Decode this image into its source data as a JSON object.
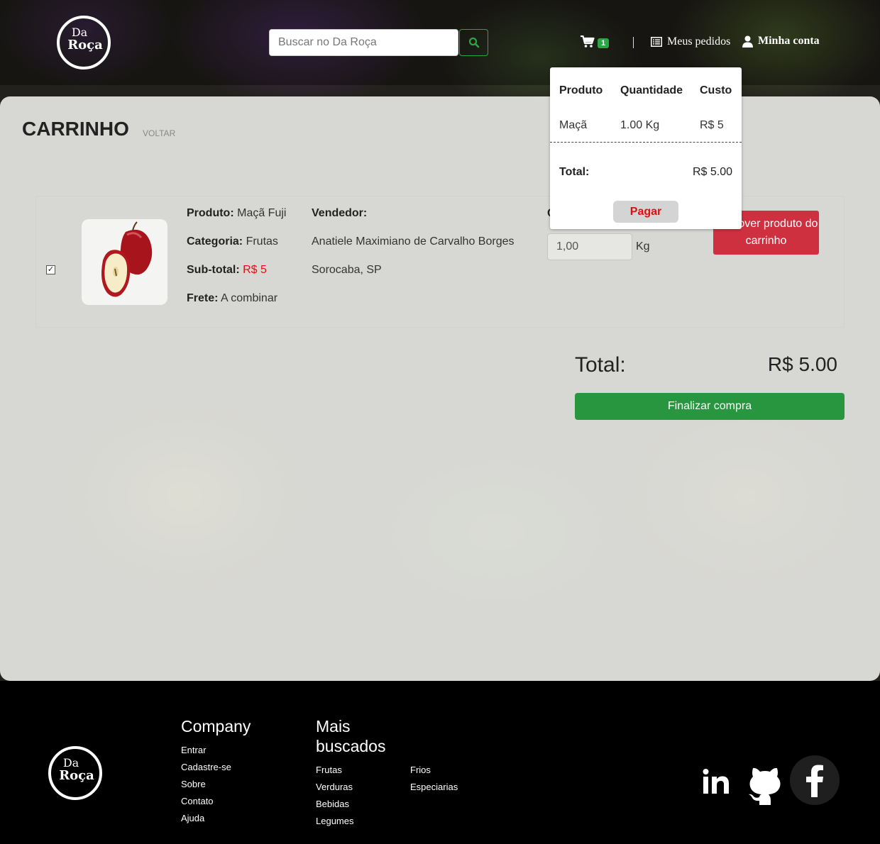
{
  "header": {
    "logo_line1": "Da",
    "logo_line2": "Roça",
    "search_placeholder": "Buscar no Da Roça",
    "cart_count": "1",
    "orders_label": "Meus pedidos",
    "account_label": "Minha conta"
  },
  "page": {
    "title": "CARRINHO",
    "back_label": "VOLTAR"
  },
  "cart_item": {
    "checked": true,
    "product_label": "Produto:",
    "product_value": "Maçã Fuji",
    "category_label": "Categoria:",
    "category_value": "Frutas",
    "subtotal_label": "Sub-total:",
    "subtotal_value": "R$ 5",
    "shipping_label": "Frete:",
    "shipping_value": "A combinar",
    "seller_label": "Vendedor:",
    "seller_name": "Anatiele Maximiano de Carvalho Borges",
    "seller_location": "Sorocaba, SP",
    "quantity_value": "1,00",
    "quantity_unit": "Kg",
    "remove_label": "Remover produto do carrinho"
  },
  "summary": {
    "total_label": "Total:",
    "total_value": "R$ 5.00",
    "checkout_label": "Finalizar compra"
  },
  "cart_popup": {
    "headers": [
      "Produto",
      "Quantidade",
      "Custo"
    ],
    "row": [
      "Maçã",
      "1.00 Kg",
      "R$ 5"
    ],
    "total_label": "Total:",
    "total_value": "R$ 5.00",
    "pay_label": "Pagar"
  },
  "footer": {
    "company_heading": "Company",
    "company_links": [
      "Entrar",
      "Cadastre-se",
      "Sobre",
      "Contato",
      "Ajuda"
    ],
    "popular_heading_1": "Mais",
    "popular_heading_2": "buscados",
    "popular_links_col1": [
      "Frutas",
      "Verduras",
      "Bebidas",
      "Legumes"
    ],
    "popular_links_col2": [
      "Frios",
      "Especiarias"
    ],
    "social": [
      "linkedin-icon",
      "github-icon",
      "facebook-icon"
    ]
  },
  "colors": {
    "green": "#28a745",
    "red": "#cf3040",
    "price_red": "#e01010"
  }
}
